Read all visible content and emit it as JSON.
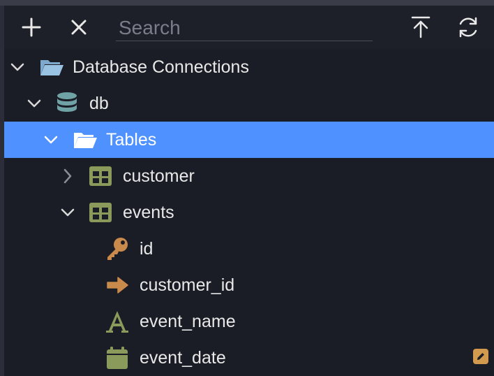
{
  "toolbar": {
    "add_icon": "plus-icon",
    "close_icon": "close-icon",
    "search_placeholder": "Search",
    "collapse_icon": "arrow-up-to-line-icon",
    "refresh_icon": "refresh-icon"
  },
  "tree": {
    "root": {
      "label": "Database Connections",
      "expanded": true,
      "icon": "folder-open-icon"
    },
    "db": {
      "label": "db",
      "expanded": true,
      "icon": "database-icon"
    },
    "tables": {
      "label": "Tables",
      "expanded": true,
      "selected": true,
      "icon": "folder-open-icon"
    },
    "table_customer": {
      "label": "customer",
      "expanded": false,
      "icon": "table-icon"
    },
    "table_events": {
      "label": "events",
      "expanded": true,
      "icon": "table-icon"
    },
    "columns": [
      {
        "label": "id",
        "icon": "key-icon"
      },
      {
        "label": "customer_id",
        "icon": "arrow-right-icon"
      },
      {
        "label": "event_name",
        "icon": "text-type-icon"
      },
      {
        "label": "event_date",
        "icon": "calendar-icon"
      }
    ]
  },
  "colors": {
    "selection": "#4f92ff",
    "folder": "#8fb7d9",
    "database": "#6fa3a6",
    "table": "#8a9a5b",
    "key": "#c98a4b",
    "calendar": "#8a9a5b",
    "edit_badge": "#d19a4f"
  }
}
